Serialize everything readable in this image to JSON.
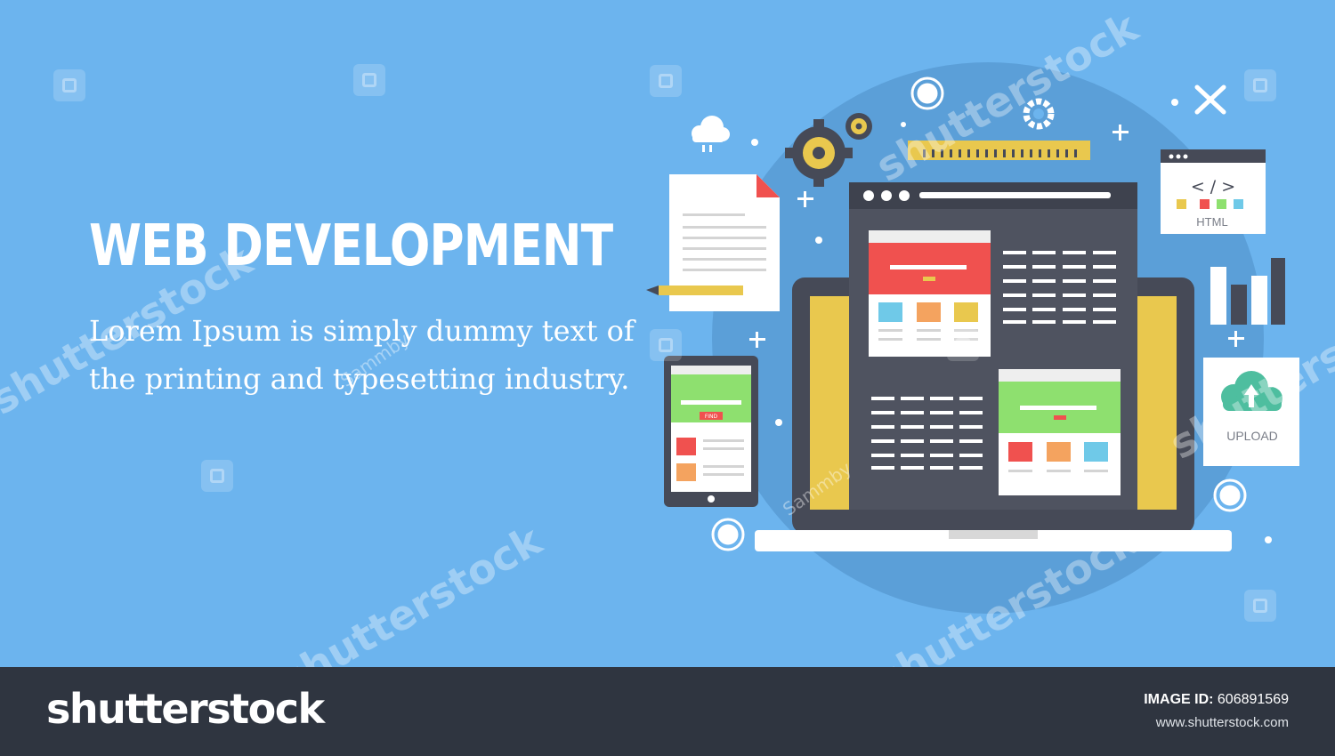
{
  "banner": {
    "headline": "WEB DEVELOPMENT",
    "body": "Lorem Ipsum is simply dummy text of the printing and typesetting industry.",
    "html_tag": "< / >",
    "html_label": "HTML",
    "upload_label": "UPLOAD",
    "find_button": "FIND",
    "contributor": "Sammby",
    "watermark_text": "shutterstock"
  },
  "colors": {
    "background": "#6cb4ee",
    "circle": "#5b9fd8",
    "dark": "#464a57",
    "yellow": "#e9c84e",
    "red": "#f0514f",
    "green": "#8ee06f",
    "orange": "#f4a35f",
    "cyan": "#6fc9e8",
    "footer": "#2f3540"
  },
  "footer": {
    "logo": "shutterstock",
    "image_id_label": "IMAGE ID:",
    "image_id_value": "606891569",
    "url": "www.shutterstock.com"
  }
}
